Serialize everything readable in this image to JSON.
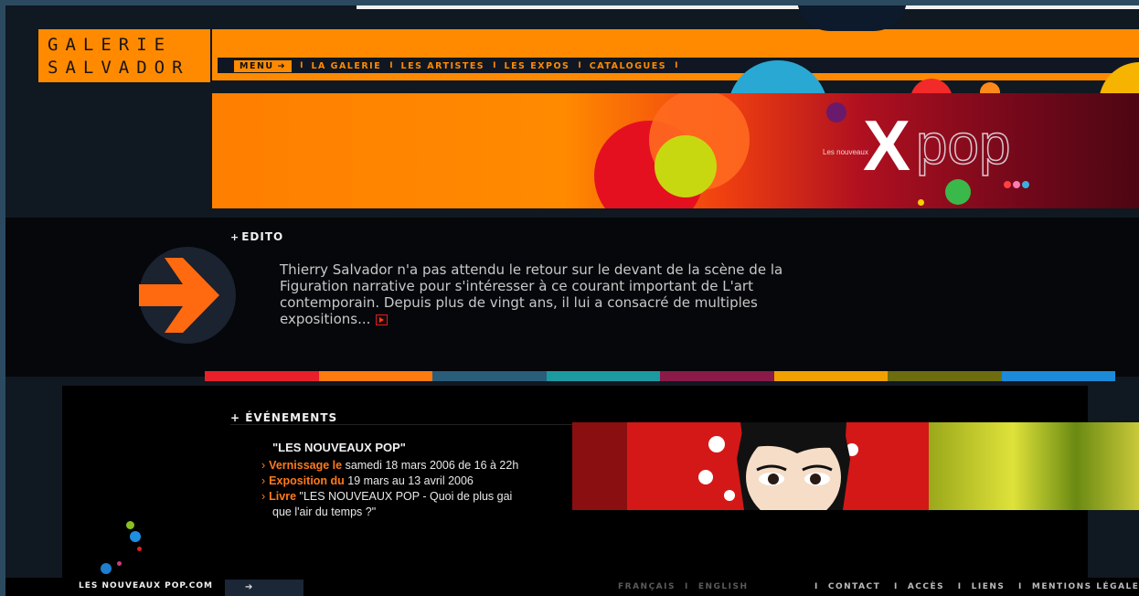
{
  "logo": {
    "line1": "GALERIE",
    "line2": "SALVADOR"
  },
  "nav": {
    "menu_label": "MENU",
    "items": [
      "LA GALERIE",
      "LES ARTISTES",
      "LES EXPOS",
      "CATALOGUES"
    ]
  },
  "banner": {
    "small_text": "Les nouveaux",
    "x_text": "X",
    "pop_text": "pop"
  },
  "edito": {
    "title": "EDITO",
    "text": "Thierry Salvador n'a pas attendu le retour sur le devant de la scène de la Figuration narrative pour s'intéresser à ce courant important de L'art contemporain. Depuis plus de vingt ans, il lui a consacré de multiples expositions..."
  },
  "events": {
    "title": "ÉVÉNEMENTS",
    "headline": "\"LES NOUVEAUX POP\"",
    "lines": [
      {
        "label": "Vernissage le",
        "text": "samedi 18 mars 2006 de 16 à 22h"
      },
      {
        "label": "Exposition du",
        "text": "19 mars au 13 avril 2006"
      },
      {
        "label": "Livre",
        "text": "\"LES NOUVEAUX POP - Quoi de plus gai"
      }
    ],
    "line4_cont": "que l'air du temps ?\""
  },
  "footer": {
    "site_link": "LES NOUVEAUX POP.COM",
    "lang": [
      "FRANÇAIS",
      "ENGLISH"
    ],
    "links": [
      "CONTACT",
      "ACCÈS",
      "LIENS",
      "MENTIONS LÉGALES"
    ]
  },
  "colors": {
    "accent": "#ff8a00",
    "stripe": [
      "#e8202a",
      "#ff7a10",
      "#2a5d7a",
      "#1c9aa0",
      "#8a1a48",
      "#f0a000",
      "#6d6d10",
      "#1b8ad8"
    ]
  }
}
